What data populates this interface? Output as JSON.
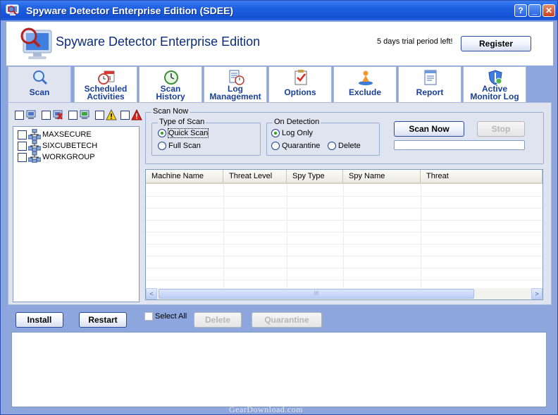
{
  "window": {
    "title": "Spyware Detector Enterprise Edition (SDEE)",
    "controls": {
      "help": "?",
      "minimize": "_",
      "close": "✕"
    }
  },
  "header": {
    "app_name": "Spyware Detector Enterprise Edition",
    "trial_text": "5 days trial period left!",
    "register_label": "Register"
  },
  "tabs": [
    {
      "label_line1": "Scan",
      "label_line2": "",
      "icon": "magnifier-icon",
      "active": true
    },
    {
      "label_line1": "Scheduled",
      "label_line2": "Activities",
      "icon": "calendar-clock-icon",
      "active": false
    },
    {
      "label_line1": "Scan",
      "label_line2": "History",
      "icon": "history-clock-icon",
      "active": false
    },
    {
      "label_line1": "Log",
      "label_line2": "Management",
      "icon": "log-document-icon",
      "active": false
    },
    {
      "label_line1": "Options",
      "label_line2": "",
      "icon": "checklist-icon",
      "active": false
    },
    {
      "label_line1": "Exclude",
      "label_line2": "",
      "icon": "exclude-figure-icon",
      "active": false
    },
    {
      "label_line1": "Report",
      "label_line2": "",
      "icon": "report-icon",
      "active": false
    },
    {
      "label_line1": "Active",
      "label_line2": "Monitor Log",
      "icon": "shield-icon",
      "active": false
    }
  ],
  "filters": [
    "computer-icon",
    "computer-red-icon",
    "computer-green-icon",
    "warning-icon",
    "error-icon"
  ],
  "tree": {
    "items": [
      {
        "label": "MAXSECURE",
        "icon": "network-group-icon"
      },
      {
        "label": "SIXCUBETECH",
        "icon": "network-group-icon"
      },
      {
        "label": "WORKGROUP",
        "icon": "network-group-icon"
      }
    ]
  },
  "scan_now": {
    "legend": "Scan Now",
    "type_legend": "Type of Scan",
    "quick_scan": "Quick Scan",
    "full_scan": "Full Scan",
    "selected_type": "Quick Scan",
    "detection_legend": "On Detection",
    "log_only": "Log Only",
    "quarantine": "Quarantine",
    "delete": "Delete",
    "selected_action": "Log Only",
    "scan_button": "Scan Now",
    "stop_button": "Stop",
    "progress": 0
  },
  "results": {
    "columns": [
      "Machine Name",
      "Threat Level",
      "Spy Type",
      "Spy Name",
      "Threat"
    ],
    "rows": [],
    "scroll_grip": "III",
    "scroll_left": "<",
    "scroll_right": ">"
  },
  "bottom": {
    "install_label": "Install",
    "restart_label": "Restart",
    "select_all_label": "Select All",
    "delete_label": "Delete",
    "quarantine_label": "Quarantine"
  },
  "watermark": "GearDownload.com",
  "colors": {
    "title_bar": "#1c5ee0",
    "frame": "#8ea6de",
    "tab_text": "#183f9a",
    "panel": "#dfe4f0"
  }
}
